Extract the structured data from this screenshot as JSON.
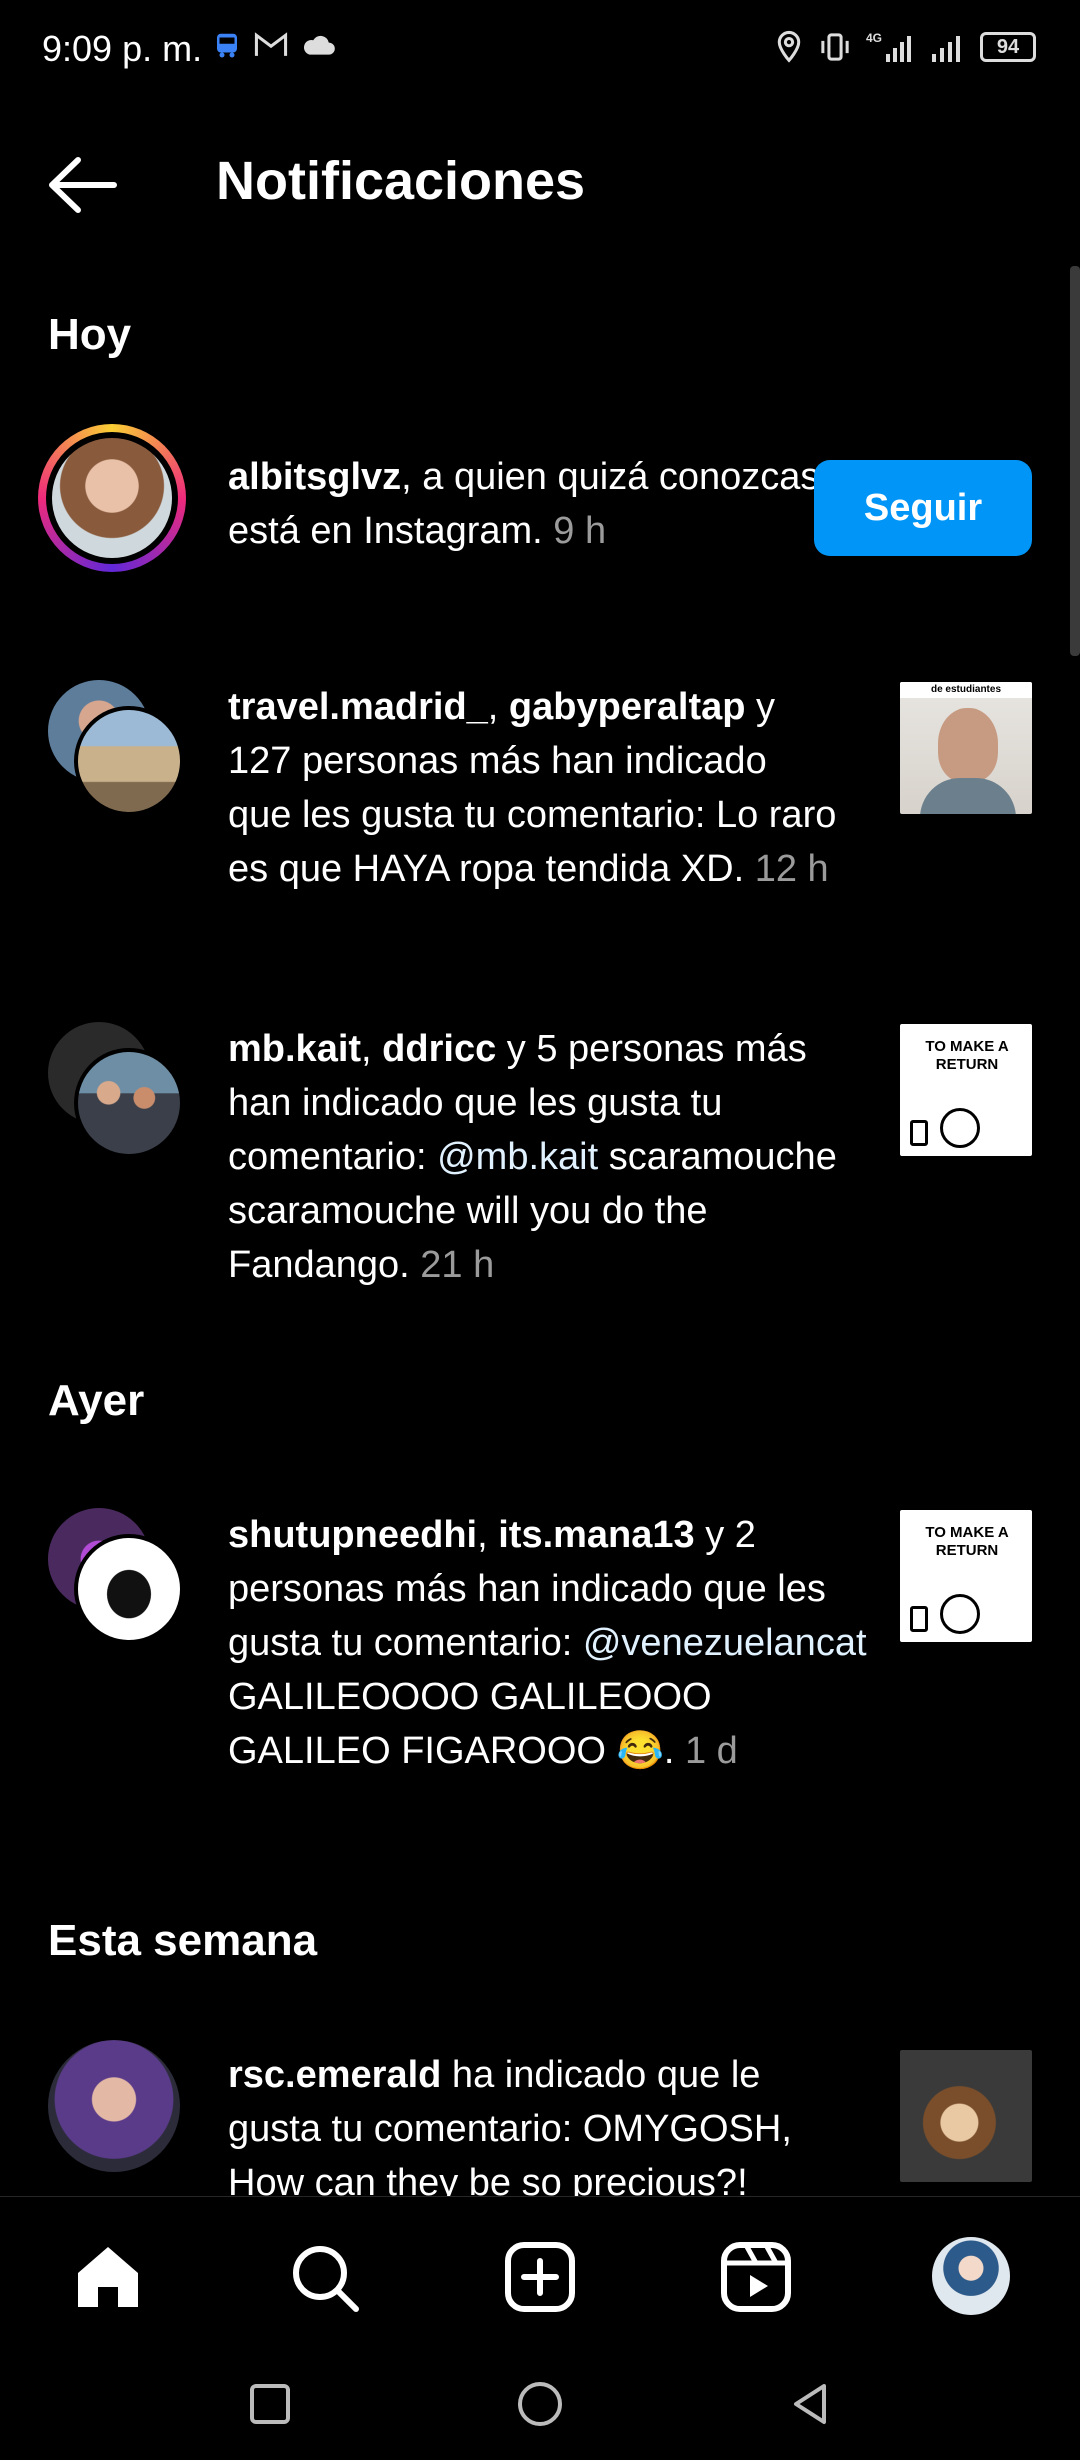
{
  "status_bar": {
    "time": "9:09 p. m.",
    "battery": "94",
    "network": "4G"
  },
  "header": {
    "title": "Notificaciones"
  },
  "sections": {
    "today": "Hoy",
    "yesterday": "Ayer",
    "this_week": "Esta semana"
  },
  "notifications": [
    {
      "user": "albitsglvz",
      "text": ", a quien quizá conozcas, está en Instagram.",
      "time": "9 h",
      "button": "Seguir"
    },
    {
      "users": [
        "travel.madrid_",
        "gabyperaltap"
      ],
      "text_pre": " y 127 personas más han indicado que les gusta tu comentario: Lo raro es que HAYA ropa tendida XD.",
      "time": "12 h",
      "thumb_label": "de estudiantes"
    },
    {
      "users": [
        "mb.kait",
        "ddricc"
      ],
      "text_pre": " y 5 personas más han indicado que les gusta tu comentario: ",
      "mention": "@mb.kait",
      "text_post": " scaramouche scaramouche will you do the Fandango.",
      "time": "21 h",
      "thumb_label": "TO MAKE A RETURN"
    },
    {
      "users": [
        "shutupneedhi",
        "its.mana13"
      ],
      "text_pre": " y 2 personas más han indicado que les gusta tu comentario: ",
      "mention": "@venezuelancat",
      "text_post": " GALILEOOOO GALILEOOO GALILEO FIGAROOO 😂.",
      "time": "1 d",
      "thumb_label": "TO MAKE A RETURN"
    },
    {
      "user": "rsc.emerald",
      "text": " ha indicado que le gusta tu comentario: OMYGOSH, How can they be so precious?!",
      "time": ""
    }
  ],
  "colors": {
    "accent": "#0095f6",
    "background": "#000000",
    "muted": "#9b9b9b"
  }
}
